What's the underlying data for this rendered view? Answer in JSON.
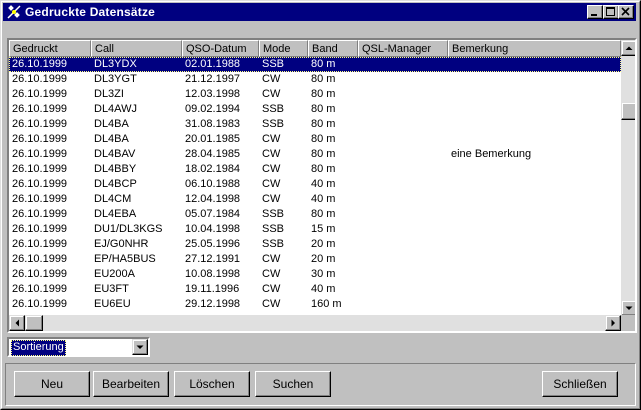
{
  "window": {
    "title": "Gedruckte Datensätze"
  },
  "table": {
    "columns": [
      "Gedruckt",
      "Call",
      "QSO-Datum",
      "Mode",
      "Band",
      "QSL-Manager",
      "Bemerkung"
    ],
    "rows": [
      [
        "26.10.1999",
        "DL3YDX",
        "02.01.1988",
        "SSB",
        "80 m",
        "",
        ""
      ],
      [
        "26.10.1999",
        "DL3YGT",
        "21.12.1997",
        "CW",
        "80 m",
        "",
        ""
      ],
      [
        "26.10.1999",
        "DL3ZI",
        "12.03.1998",
        "CW",
        "80 m",
        "",
        ""
      ],
      [
        "26.10.1999",
        "DL4AWJ",
        "09.02.1994",
        "SSB",
        "80 m",
        "",
        ""
      ],
      [
        "26.10.1999",
        "DL4BA",
        "31.08.1983",
        "SSB",
        "80 m",
        "",
        ""
      ],
      [
        "26.10.1999",
        "DL4BA",
        "20.01.1985",
        "CW",
        "80 m",
        "",
        ""
      ],
      [
        "26.10.1999",
        "DL4BAV",
        "28.04.1985",
        "CW",
        "80 m",
        "",
        "eine Bemerkung"
      ],
      [
        "26.10.1999",
        "DL4BBY",
        "18.02.1984",
        "CW",
        "80 m",
        "",
        ""
      ],
      [
        "26.10.1999",
        "DL4BCP",
        "06.10.1988",
        "CW",
        "40 m",
        "",
        ""
      ],
      [
        "26.10.1999",
        "DL4CM",
        "12.04.1998",
        "CW",
        "40 m",
        "",
        ""
      ],
      [
        "26.10.1999",
        "DL4EBA",
        "05.07.1984",
        "SSB",
        "80 m",
        "",
        ""
      ],
      [
        "26.10.1999",
        "DU1/DL3KGS",
        "10.04.1998",
        "SSB",
        "15 m",
        "",
        ""
      ],
      [
        "26.10.1999",
        "EJ/G0NHR",
        "25.05.1996",
        "SSB",
        "20 m",
        "",
        ""
      ],
      [
        "26.10.1999",
        "EP/HA5BUS",
        "27.12.1991",
        "CW",
        "20 m",
        "",
        ""
      ],
      [
        "26.10.1999",
        "EU200A",
        "10.08.1998",
        "CW",
        "30 m",
        "",
        ""
      ],
      [
        "26.10.1999",
        "EU3FT",
        "19.11.1996",
        "CW",
        "40 m",
        "",
        ""
      ],
      [
        "26.10.1999",
        "EU6EU",
        "29.12.1998",
        "CW",
        "160 m",
        "",
        ""
      ]
    ],
    "selected_row": 0
  },
  "sort": {
    "selected": "Sortierung"
  },
  "buttons": {
    "neu": "Neu",
    "bearbeiten": "Bearbeiten",
    "loeschen": "Löschen",
    "suchen": "Suchen",
    "schliessen": "Schließen"
  },
  "icons": {
    "app": "satellite-icon",
    "minimize": "minimize-icon",
    "maximize": "maximize-icon",
    "close": "close-icon"
  },
  "colors": {
    "selection": "#000080",
    "titlebar": "#000080",
    "face": "#c0c0c0"
  }
}
